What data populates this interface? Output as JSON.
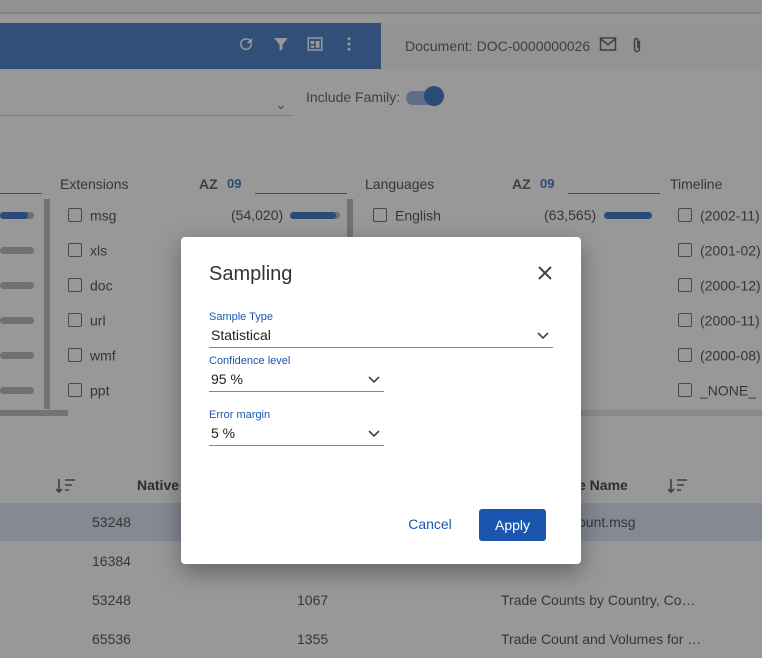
{
  "toolbar": {
    "icons": [
      "refresh-icon",
      "filter-icon",
      "layout-icon",
      "more-vertical-icon"
    ],
    "document_label": "Document: DOC-0000000026",
    "doc_icons": [
      "email-icon",
      "attachment-icon"
    ]
  },
  "filters": {
    "include_family_label": "Include Family:",
    "include_family_enabled": true
  },
  "facets": {
    "extensions": {
      "header": "Extensions",
      "sort_az": "AZ",
      "sort_09": "09",
      "items": [
        {
          "label": "msg",
          "count": "(54,020)"
        },
        {
          "label": "xls",
          "count": ""
        },
        {
          "label": "doc",
          "count": ""
        },
        {
          "label": "url",
          "count": ""
        },
        {
          "label": "wmf",
          "count": ""
        },
        {
          "label": "ppt",
          "count": ""
        }
      ]
    },
    "languages": {
      "header": "Languages",
      "sort_az": "AZ",
      "sort_09": "09",
      "items": [
        {
          "label": "English",
          "count": "(63,565)"
        }
      ]
    },
    "timeline": {
      "header": "Timeline",
      "items": [
        {
          "label": "(2002-11)"
        },
        {
          "label": "(2001-02)"
        },
        {
          "label": "(2000-12)"
        },
        {
          "label": "(2000-11)"
        },
        {
          "label": "(2000-08)"
        },
        {
          "label": "_NONE_"
        }
      ]
    }
  },
  "table": {
    "headers": {
      "native": "Native",
      "file_name": "e Name"
    },
    "rows": [
      {
        "size": "53248",
        "num": "",
        "name": "ount.msg",
        "selected": true
      },
      {
        "size": "16384",
        "num": "",
        "name": "",
        "selected": false
      },
      {
        "size": "53248",
        "num": "1067",
        "name": "Trade Counts by Country, Co…",
        "selected": false
      },
      {
        "size": "65536",
        "num": "1355",
        "name": "Trade Count and Volumes for …",
        "selected": false
      }
    ]
  },
  "dialog": {
    "title": "Sampling",
    "close_icon": "close-icon",
    "sample_type": {
      "label": "Sample Type",
      "value": "Statistical"
    },
    "confidence_level": {
      "label": "Confidence level",
      "value": "95 %"
    },
    "error_margin": {
      "label": "Error margin",
      "value": "5 %"
    },
    "cancel_label": "Cancel",
    "apply_label": "Apply"
  },
  "colors": {
    "accent": "#2f6cc3",
    "toolbar": "#3d74c6",
    "apply_button": "#1a56b0"
  }
}
